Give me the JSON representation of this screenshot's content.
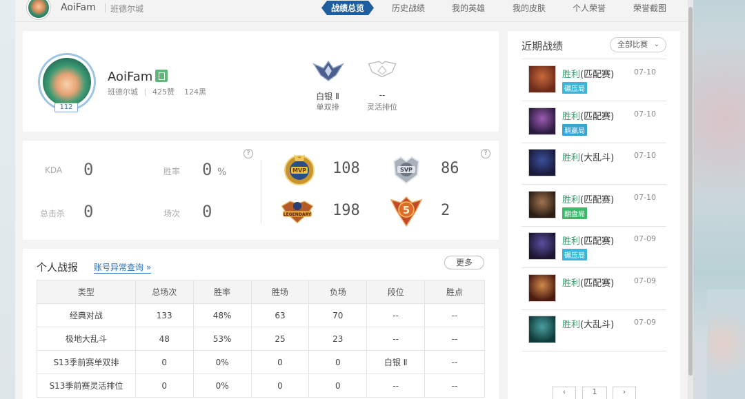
{
  "nav": {
    "user_name": "AoiFam",
    "server": "班德尔城",
    "tabs": [
      "战绩总览",
      "历史战绩",
      "我的英雄",
      "我的皮肤",
      "个人荣誉",
      "荣誉截图"
    ],
    "active_tab": "战绩总览"
  },
  "profile": {
    "name": "AoiFam",
    "server": "班德尔城",
    "likes": "425赞",
    "blacks": "124黑",
    "level": "112",
    "ranks": [
      {
        "tier": "白银 Ⅱ",
        "queue": "单双排"
      },
      {
        "tier": "--",
        "queue": "灵活排位"
      }
    ]
  },
  "stats": {
    "kda_label": "KDA",
    "kda_value": "0",
    "winrate_label": "胜率",
    "winrate_value": "0",
    "winrate_unit": "%",
    "kills_label": "总击杀",
    "kills_value": "0",
    "games_label": "场次",
    "games_value": "0",
    "help": "?",
    "medals": [
      {
        "name": "MVP",
        "count": "108"
      },
      {
        "name": "SVP",
        "count": "86"
      },
      {
        "name": "LEGENDARY",
        "count": "198"
      },
      {
        "name": "5",
        "count": "2"
      }
    ]
  },
  "report": {
    "title": "个人战报",
    "link": "账号异常查询 »",
    "more": "更多",
    "headers": [
      "类型",
      "总场次",
      "胜率",
      "胜场",
      "负场",
      "段位",
      "胜点"
    ],
    "rows": [
      [
        "经典对战",
        "133",
        "48%",
        "63",
        "70",
        "--",
        "--"
      ],
      [
        "极地大乱斗",
        "48",
        "53%",
        "25",
        "23",
        "--",
        "--"
      ],
      [
        "S13季前赛单双排",
        "0",
        "0%",
        "0",
        "0",
        "白银 Ⅱ",
        "--"
      ],
      [
        "S13季前赛灵活排位",
        "0",
        "0%",
        "0",
        "0",
        "--",
        "--"
      ]
    ]
  },
  "recent": {
    "title": "近期战绩",
    "filter": "全部比赛",
    "matches": [
      {
        "result": "胜利",
        "mode": "(匹配赛)",
        "date": "07-10",
        "tag": "碾压局",
        "tag_color": "#3bb5d8",
        "hero_colors": [
          "#6b2a1a",
          "#c8693a"
        ]
      },
      {
        "result": "胜利",
        "mode": "(匹配赛)",
        "date": "07-10",
        "tag": "躺赢局",
        "tag_color": "#3aa3d6",
        "hero_colors": [
          "#2a1a3e",
          "#9c5bb0"
        ]
      },
      {
        "result": "胜利",
        "mode": "(大乱斗)",
        "date": "07-10",
        "tag": "",
        "tag_color": "",
        "hero_colors": [
          "#1a1a3a",
          "#3b4f9a"
        ]
      },
      {
        "result": "胜利",
        "mode": "(匹配赛)",
        "date": "07-10",
        "tag": "翻盘局",
        "tag_color": "#3cb86a",
        "hero_colors": [
          "#2b1d14",
          "#a0734f"
        ]
      },
      {
        "result": "胜利",
        "mode": "(匹配赛)",
        "date": "07-09",
        "tag": "碾压局",
        "tag_color": "#3bb5d8",
        "hero_colors": [
          "#1c1530",
          "#5b4fa0"
        ]
      },
      {
        "result": "胜利",
        "mode": "(匹配赛)",
        "date": "07-09",
        "tag": "",
        "tag_color": "",
        "hero_colors": [
          "#4a1a10",
          "#d08a4a"
        ]
      },
      {
        "result": "胜利",
        "mode": "(大乱斗)",
        "date": "07-09",
        "tag": "",
        "tag_color": "",
        "hero_colors": [
          "#0f3a3a",
          "#4aa0a0"
        ]
      }
    ],
    "pager": {
      "prev": "‹",
      "page": "1",
      "next": "›"
    }
  }
}
